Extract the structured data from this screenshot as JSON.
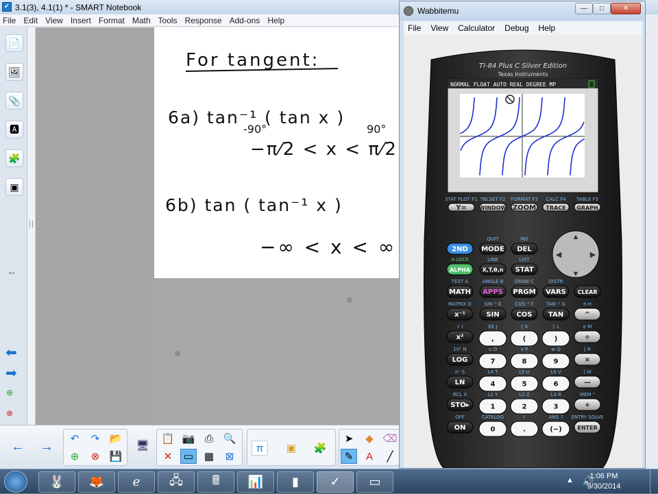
{
  "notebook": {
    "title": "3.1(3), 4.1(1) * - SMART Notebook",
    "menu": [
      "File",
      "Edit",
      "View",
      "Insert",
      "Format",
      "Math",
      "Tools",
      "Response",
      "Add-ons",
      "Help"
    ],
    "ink": {
      "heading": "For tangent:",
      "p6a_expr": "6a)  tan⁻¹ ( tan x )",
      "p6a_deg": "-90°",
      "p6a_deg2": "90°",
      "p6a_range": "−π⁄2 < x < π⁄2",
      "p6b_expr": "6b)  tan ( tan⁻¹ x )",
      "p6b_range": "−∞ < x < ∞"
    },
    "toolbar": {
      "pi_symbol": "π"
    }
  },
  "wabbitemu": {
    "title": "Wabbitemu",
    "menu": [
      "File",
      "View",
      "Calculator",
      "Debug",
      "Help"
    ],
    "calc": {
      "model": "TI-84 Plus C Silver Edition",
      "brand": "Texas Instruments",
      "status_bar": "NORMAL FLOAT AUTO REAL DEGREE MP",
      "fn_top": [
        "STAT PLOT F1",
        "TBLSET F2",
        "FORMAT F3",
        "CALC F4",
        "TABLE F5"
      ],
      "fn_keys": [
        "Y=",
        "WINDOW",
        "ZOOM",
        "TRACE",
        "GRAPH"
      ],
      "row1": [
        "2ND",
        "MODE",
        "DEL"
      ],
      "row1_top": [
        "QUIT",
        "INS"
      ],
      "row2": [
        "ALPHA",
        "X,T,θ,n",
        "STAT"
      ],
      "row2_top": [
        "A-LOCK",
        "LINK",
        "LIST"
      ],
      "row3": [
        "MATH",
        "APPS",
        "PRGM",
        "VARS",
        "CLEAR"
      ],
      "row3_top": [
        "TEST A",
        "ANGLE B",
        "DRAW C",
        "DISTR"
      ],
      "row4": [
        "x⁻¹",
        "SIN",
        "COS",
        "TAN",
        "^"
      ],
      "row4_top": [
        "MATRIX D",
        "SIN⁻¹ E",
        "COS⁻¹ F",
        "TAN⁻¹ G",
        "π H"
      ],
      "row5": [
        "x²",
        ",",
        "(",
        ")",
        "÷"
      ],
      "row5_top": [
        "√ I",
        "EE J",
        "{ K",
        "} L",
        "e M"
      ],
      "row6": [
        "LOG",
        "7",
        "8",
        "9",
        "×"
      ],
      "row6_top": [
        "10ˣ N",
        "u O",
        "v P",
        "w Q",
        "[ R"
      ],
      "row7": [
        "LN",
        "4",
        "5",
        "6",
        "—"
      ],
      "row7_top": [
        "eˣ S",
        "L4 T",
        "L5 U",
        "L6 V",
        "] W"
      ],
      "row8": [
        "STO▸",
        "1",
        "2",
        "3",
        "+"
      ],
      "row8_top": [
        "RCL X",
        "L1 Y",
        "L2 Z",
        "L3 θ",
        "MEM \""
      ],
      "row9": [
        "ON",
        "0",
        ".",
        "(−)",
        "ENTER"
      ],
      "row9_top": [
        "OFF",
        "CATALOG",
        "i",
        "ANS ?",
        "ENTRY SOLVE"
      ]
    }
  },
  "taskbar": {
    "time": "1:06 PM",
    "date": "9/30/2014"
  }
}
